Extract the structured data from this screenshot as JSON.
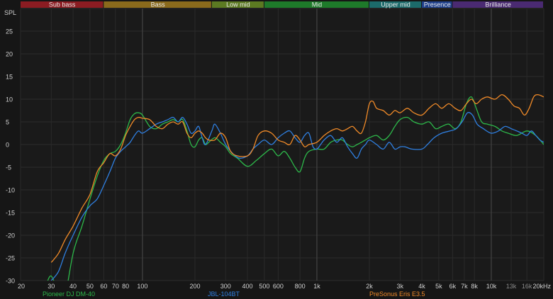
{
  "chart_data": {
    "type": "line",
    "title": "",
    "ylabel": "SPL",
    "xlabel": "",
    "x_scale": "log",
    "xlim": [
      20,
      20000
    ],
    "ylim": [
      -30,
      30
    ],
    "grid": true,
    "legend_position": "bottom",
    "y_ticks": [
      "25",
      "20",
      "15",
      "10",
      "5",
      "0",
      "-5",
      "-10",
      "-15",
      "-20",
      "-25",
      "-30"
    ],
    "x_ticks": [
      {
        "v": 20,
        "label": "20",
        "dim": false
      },
      {
        "v": 30,
        "label": "30",
        "dim": false
      },
      {
        "v": 40,
        "label": "40",
        "dim": false
      },
      {
        "v": 50,
        "label": "50",
        "dim": false
      },
      {
        "v": 60,
        "label": "60",
        "dim": false
      },
      {
        "v": 70,
        "label": "70",
        "dim": false
      },
      {
        "v": 80,
        "label": "80",
        "dim": false
      },
      {
        "v": 100,
        "label": "100",
        "dim": false
      },
      {
        "v": 200,
        "label": "200",
        "dim": false
      },
      {
        "v": 300,
        "label": "300",
        "dim": false
      },
      {
        "v": 400,
        "label": "400",
        "dim": false
      },
      {
        "v": 500,
        "label": "500",
        "dim": false
      },
      {
        "v": 600,
        "label": "600",
        "dim": false
      },
      {
        "v": 800,
        "label": "800",
        "dim": false
      },
      {
        "v": 1000,
        "label": "1k",
        "dim": false
      },
      {
        "v": 2000,
        "label": "2k",
        "dim": false
      },
      {
        "v": 3000,
        "label": "3k",
        "dim": false
      },
      {
        "v": 4000,
        "label": "4k",
        "dim": false
      },
      {
        "v": 5000,
        "label": "5k",
        "dim": false
      },
      {
        "v": 6000,
        "label": "6k",
        "dim": false
      },
      {
        "v": 7000,
        "label": "7k",
        "dim": false
      },
      {
        "v": 8000,
        "label": "8k",
        "dim": false
      },
      {
        "v": 10000,
        "label": "10k",
        "dim": false
      },
      {
        "v": 13000,
        "label": "13k",
        "dim": true
      },
      {
        "v": 16000,
        "label": "16k",
        "dim": true
      },
      {
        "v": 20000,
        "label": "20kHz",
        "dim": false
      }
    ],
    "major_x_lines": [
      100,
      1000,
      10000
    ],
    "bands": [
      {
        "label": "Sub bass",
        "from": 20,
        "to": 60,
        "color": "#8b1c22"
      },
      {
        "label": "Bass",
        "from": 60,
        "to": 250,
        "color": "#8a6a1c"
      },
      {
        "label": "Low mid",
        "from": 250,
        "to": 500,
        "color": "#5c7a22"
      },
      {
        "label": "Mid",
        "from": 500,
        "to": 2000,
        "color": "#1e7a2a"
      },
      {
        "label": "Upper mid",
        "from": 2000,
        "to": 4000,
        "color": "#1c6a6a"
      },
      {
        "label": "Presence",
        "from": 4000,
        "to": 6000,
        "color": "#1e3f8a"
      },
      {
        "label": "Brilliance",
        "from": 6000,
        "to": 20000,
        "color": "#4a2a72"
      }
    ],
    "series": [
      {
        "name": "Pioneer DJ DM-40",
        "color": "#2db84a",
        "points": [
          [
            28,
            -31
          ],
          [
            30,
            -29
          ],
          [
            33,
            -33
          ],
          [
            35,
            -36
          ],
          [
            40,
            -24
          ],
          [
            45,
            -18
          ],
          [
            50,
            -12
          ],
          [
            55,
            -7
          ],
          [
            60,
            -3.5
          ],
          [
            65,
            -2
          ],
          [
            70,
            -1.5
          ],
          [
            75,
            0
          ],
          [
            80,
            2.5
          ],
          [
            85,
            5.5
          ],
          [
            90,
            6.8
          ],
          [
            95,
            7
          ],
          [
            100,
            6.5
          ],
          [
            110,
            4
          ],
          [
            120,
            3.5
          ],
          [
            130,
            4.5
          ],
          [
            140,
            5
          ],
          [
            150,
            5.5
          ],
          [
            160,
            5
          ],
          [
            170,
            5.5
          ],
          [
            180,
            3
          ],
          [
            190,
            0
          ],
          [
            200,
            -0.5
          ],
          [
            210,
            1
          ],
          [
            220,
            1.5
          ],
          [
            230,
            0
          ],
          [
            240,
            0.5
          ],
          [
            260,
            1.5
          ],
          [
            280,
            0.5
          ],
          [
            300,
            -0.5
          ],
          [
            320,
            -2
          ],
          [
            350,
            -3
          ],
          [
            400,
            -4.8
          ],
          [
            450,
            -3.5
          ],
          [
            500,
            -2
          ],
          [
            550,
            -1
          ],
          [
            600,
            -2.5
          ],
          [
            650,
            -1.5
          ],
          [
            700,
            -3
          ],
          [
            750,
            -5
          ],
          [
            800,
            -6
          ],
          [
            850,
            -3
          ],
          [
            900,
            -1.5
          ],
          [
            1000,
            -1
          ],
          [
            1100,
            -1
          ],
          [
            1200,
            0.5
          ],
          [
            1300,
            1
          ],
          [
            1400,
            1
          ],
          [
            1500,
            0
          ],
          [
            1600,
            -0.5
          ],
          [
            1700,
            0
          ],
          [
            1800,
            0.5
          ],
          [
            1900,
            1
          ],
          [
            2000,
            1.5
          ],
          [
            2200,
            2
          ],
          [
            2400,
            1
          ],
          [
            2600,
            2
          ],
          [
            2800,
            4
          ],
          [
            3000,
            5.5
          ],
          [
            3300,
            6
          ],
          [
            3600,
            5
          ],
          [
            4000,
            4.5
          ],
          [
            4400,
            5
          ],
          [
            4800,
            3.5
          ],
          [
            5200,
            4
          ],
          [
            5700,
            4.5
          ],
          [
            6200,
            3.5
          ],
          [
            6700,
            5
          ],
          [
            7200,
            9
          ],
          [
            7700,
            10.5
          ],
          [
            8200,
            8
          ],
          [
            8800,
            5
          ],
          [
            9500,
            4.5
          ],
          [
            10500,
            4
          ],
          [
            11500,
            3
          ],
          [
            12500,
            2.5
          ],
          [
            14000,
            2
          ],
          [
            16000,
            3
          ],
          [
            18000,
            2
          ],
          [
            20000,
            0
          ]
        ]
      },
      {
        "name": "JBL-104BT",
        "color": "#2f7fe0",
        "points": [
          [
            30,
            -30
          ],
          [
            33,
            -28
          ],
          [
            36,
            -24
          ],
          [
            40,
            -20
          ],
          [
            45,
            -16
          ],
          [
            50,
            -13.5
          ],
          [
            55,
            -12
          ],
          [
            60,
            -9
          ],
          [
            65,
            -6
          ],
          [
            70,
            -3
          ],
          [
            75,
            -1.5
          ],
          [
            80,
            -0.5
          ],
          [
            85,
            0.5
          ],
          [
            90,
            2
          ],
          [
            95,
            3
          ],
          [
            100,
            2.5
          ],
          [
            110,
            3.5
          ],
          [
            120,
            4.5
          ],
          [
            130,
            5
          ],
          [
            140,
            5.5
          ],
          [
            150,
            6
          ],
          [
            160,
            5
          ],
          [
            170,
            6
          ],
          [
            180,
            4.5
          ],
          [
            190,
            2.5
          ],
          [
            200,
            3
          ],
          [
            210,
            4
          ],
          [
            220,
            1.5
          ],
          [
            230,
            0
          ],
          [
            250,
            3
          ],
          [
            260,
            4.5
          ],
          [
            280,
            2.5
          ],
          [
            300,
            0
          ],
          [
            330,
            -2
          ],
          [
            360,
            -3
          ],
          [
            400,
            -2.5
          ],
          [
            430,
            -1
          ],
          [
            460,
            0
          ],
          [
            500,
            1
          ],
          [
            550,
            0
          ],
          [
            600,
            1.5
          ],
          [
            650,
            2.5
          ],
          [
            700,
            3
          ],
          [
            750,
            1.5
          ],
          [
            800,
            0.5
          ],
          [
            850,
            2
          ],
          [
            900,
            2.5
          ],
          [
            950,
            -0.5
          ],
          [
            1000,
            -1
          ],
          [
            1050,
            0
          ],
          [
            1100,
            1
          ],
          [
            1200,
            2
          ],
          [
            1300,
            0.5
          ],
          [
            1400,
            1.5
          ],
          [
            1500,
            -0.5
          ],
          [
            1600,
            -2
          ],
          [
            1700,
            -3
          ],
          [
            1800,
            -1
          ],
          [
            1900,
            0
          ],
          [
            2000,
            1
          ],
          [
            2200,
            0
          ],
          [
            2400,
            -1
          ],
          [
            2600,
            0.5
          ],
          [
            2800,
            -1
          ],
          [
            3000,
            -0.5
          ],
          [
            3200,
            -0.5
          ],
          [
            3500,
            -1
          ],
          [
            4000,
            -1
          ],
          [
            4300,
            0
          ],
          [
            4700,
            1.5
          ],
          [
            5200,
            2.5
          ],
          [
            5800,
            3
          ],
          [
            6300,
            3.5
          ],
          [
            6800,
            5
          ],
          [
            7300,
            7
          ],
          [
            7800,
            6.5
          ],
          [
            8300,
            4.5
          ],
          [
            9000,
            3.5
          ],
          [
            10000,
            2.5
          ],
          [
            11000,
            3
          ],
          [
            12000,
            4
          ],
          [
            13000,
            3.5
          ],
          [
            14000,
            3
          ],
          [
            15000,
            2.5
          ],
          [
            16000,
            2
          ],
          [
            17000,
            3
          ],
          [
            18000,
            2
          ],
          [
            19000,
            1
          ],
          [
            20000,
            0.5
          ]
        ]
      },
      {
        "name": "PreSonus Eris E3.5",
        "color": "#f08a28",
        "points": [
          [
            30,
            -26
          ],
          [
            33,
            -24
          ],
          [
            36,
            -21
          ],
          [
            40,
            -18
          ],
          [
            45,
            -14
          ],
          [
            50,
            -11
          ],
          [
            55,
            -6
          ],
          [
            60,
            -4
          ],
          [
            65,
            -2
          ],
          [
            70,
            -2.5
          ],
          [
            75,
            -1
          ],
          [
            80,
            2
          ],
          [
            85,
            4
          ],
          [
            90,
            5.5
          ],
          [
            95,
            6
          ],
          [
            100,
            5.8
          ],
          [
            110,
            5.5
          ],
          [
            120,
            4
          ],
          [
            130,
            3.5
          ],
          [
            140,
            4.5
          ],
          [
            150,
            5
          ],
          [
            160,
            4.5
          ],
          [
            170,
            5
          ],
          [
            180,
            2.5
          ],
          [
            190,
            1.5
          ],
          [
            200,
            2.5
          ],
          [
            210,
            3
          ],
          [
            220,
            2.5
          ],
          [
            230,
            1.5
          ],
          [
            240,
            1
          ],
          [
            260,
            1
          ],
          [
            280,
            2.5
          ],
          [
            300,
            1.5
          ],
          [
            320,
            -1.5
          ],
          [
            350,
            -2.5
          ],
          [
            400,
            -2.5
          ],
          [
            430,
            -1
          ],
          [
            460,
            2
          ],
          [
            500,
            3
          ],
          [
            550,
            2.5
          ],
          [
            600,
            1
          ],
          [
            650,
            0.5
          ],
          [
            700,
            0
          ],
          [
            750,
            2
          ],
          [
            800,
            1
          ],
          [
            850,
            -0.5
          ],
          [
            900,
            0
          ],
          [
            1000,
            0.5
          ],
          [
            1100,
            2
          ],
          [
            1200,
            3
          ],
          [
            1300,
            3.5
          ],
          [
            1400,
            3
          ],
          [
            1500,
            3.5
          ],
          [
            1600,
            4
          ],
          [
            1700,
            3
          ],
          [
            1800,
            2.5
          ],
          [
            1900,
            5
          ],
          [
            2000,
            9
          ],
          [
            2100,
            9.5
          ],
          [
            2200,
            8
          ],
          [
            2400,
            7.5
          ],
          [
            2600,
            6.5
          ],
          [
            2800,
            7.5
          ],
          [
            3000,
            7
          ],
          [
            3300,
            8
          ],
          [
            3600,
            7
          ],
          [
            4000,
            6.5
          ],
          [
            4400,
            8
          ],
          [
            4800,
            9
          ],
          [
            5200,
            8
          ],
          [
            5700,
            9
          ],
          [
            6200,
            8
          ],
          [
            6700,
            7.5
          ],
          [
            7200,
            9
          ],
          [
            7700,
            10
          ],
          [
            8200,
            9
          ],
          [
            8800,
            10
          ],
          [
            9500,
            10.5
          ],
          [
            10500,
            10
          ],
          [
            11500,
            11
          ],
          [
            12500,
            10
          ],
          [
            13500,
            8.5
          ],
          [
            14500,
            8
          ],
          [
            15500,
            6.5
          ],
          [
            16500,
            8
          ],
          [
            17500,
            10.5
          ],
          [
            18500,
            11
          ],
          [
            20000,
            10.5
          ]
        ]
      }
    ]
  }
}
